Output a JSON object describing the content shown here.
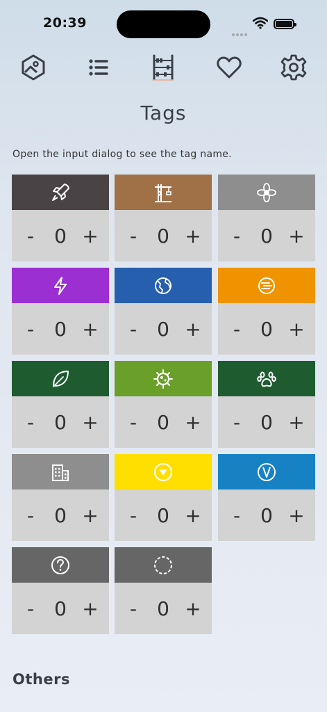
{
  "status": {
    "time": "20:39"
  },
  "nav": [
    {
      "name": "gallery-icon"
    },
    {
      "name": "list-icon"
    },
    {
      "name": "abacus-icon"
    },
    {
      "name": "heart-icon"
    },
    {
      "name": "settings-icon"
    }
  ],
  "page": {
    "title": "Tags",
    "hint": "Open the input dialog to see the tag name.",
    "others": "Others"
  },
  "tags": [
    {
      "icon": "rocket-icon",
      "color": "#4a4346",
      "count": "0",
      "minus": "-",
      "plus": "+"
    },
    {
      "icon": "crane-icon",
      "color": "#a07046",
      "count": "0",
      "minus": "-",
      "plus": "+"
    },
    {
      "icon": "flower-icon",
      "color": "#8e8e8e",
      "count": "0",
      "minus": "-",
      "plus": "+"
    },
    {
      "icon": "lightning-icon",
      "color": "#9c2fd2",
      "count": "0",
      "minus": "-",
      "plus": "+"
    },
    {
      "icon": "globe-icon",
      "color": "#265fad",
      "count": "0",
      "minus": "-",
      "plus": "+"
    },
    {
      "icon": "text-circle-icon",
      "color": "#ef9400",
      "count": "0",
      "minus": "-",
      "plus": "+"
    },
    {
      "icon": "leaf-icon",
      "color": "#1e5c30",
      "count": "0",
      "minus": "-",
      "plus": "+"
    },
    {
      "icon": "virus-icon",
      "color": "#6a9f2a",
      "count": "0",
      "minus": "-",
      "plus": "+"
    },
    {
      "icon": "paw-icon",
      "color": "#1e5c30",
      "count": "0",
      "minus": "-",
      "plus": "+"
    },
    {
      "icon": "building-icon",
      "color": "#8e8e8e",
      "count": "0",
      "minus": "-",
      "plus": "+"
    },
    {
      "icon": "triangle-circle-icon",
      "color": "#ffdf00",
      "count": "0",
      "minus": "-",
      "plus": "+"
    },
    {
      "icon": "v-circle-icon",
      "color": "#1682c4",
      "count": "0",
      "minus": "-",
      "plus": "+"
    },
    {
      "icon": "question-icon",
      "color": "#666666",
      "count": "0",
      "minus": "-",
      "plus": "+"
    },
    {
      "icon": "dashed-circle-icon",
      "color": "#666666",
      "count": "0",
      "minus": "-",
      "plus": "+"
    }
  ]
}
